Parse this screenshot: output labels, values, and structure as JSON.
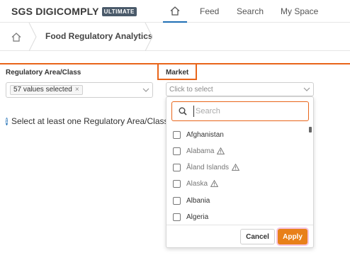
{
  "nav": {
    "logo_text": "SGS DIGICOMPLY",
    "logo_badge": "ULTIMATE",
    "links": [
      "Feed",
      "Search",
      "My Space"
    ]
  },
  "breadcrumb": {
    "title": "Food Regulatory Analytics"
  },
  "filters": {
    "regulatory": {
      "label": "Regulatory Area/Class",
      "chip": "57 values selected",
      "chip_remove": "×"
    },
    "market": {
      "label": "Market",
      "placeholder": "Click to select"
    }
  },
  "info": {
    "icon": "i",
    "text": "Select at least one Regulatory Area/Class a"
  },
  "dropdown": {
    "search_placeholder": "Search",
    "options": [
      {
        "label": "Afghanistan",
        "warning": false
      },
      {
        "label": "Alabama",
        "warning": true
      },
      {
        "label": "Åland Islands",
        "warning": true
      },
      {
        "label": "Alaska",
        "warning": true
      },
      {
        "label": "Albania",
        "warning": false
      },
      {
        "label": "Algeria",
        "warning": false
      }
    ],
    "cancel_label": "Cancel",
    "apply_label": "Apply"
  },
  "colors": {
    "accent": "#e8651a",
    "apply": "#e8801a",
    "nav_active": "#1f6fb5",
    "info": "#1f6fb5"
  },
  "icons": [
    "home-icon",
    "chevron-down-icon",
    "search-icon",
    "warning-icon",
    "info-icon"
  ]
}
